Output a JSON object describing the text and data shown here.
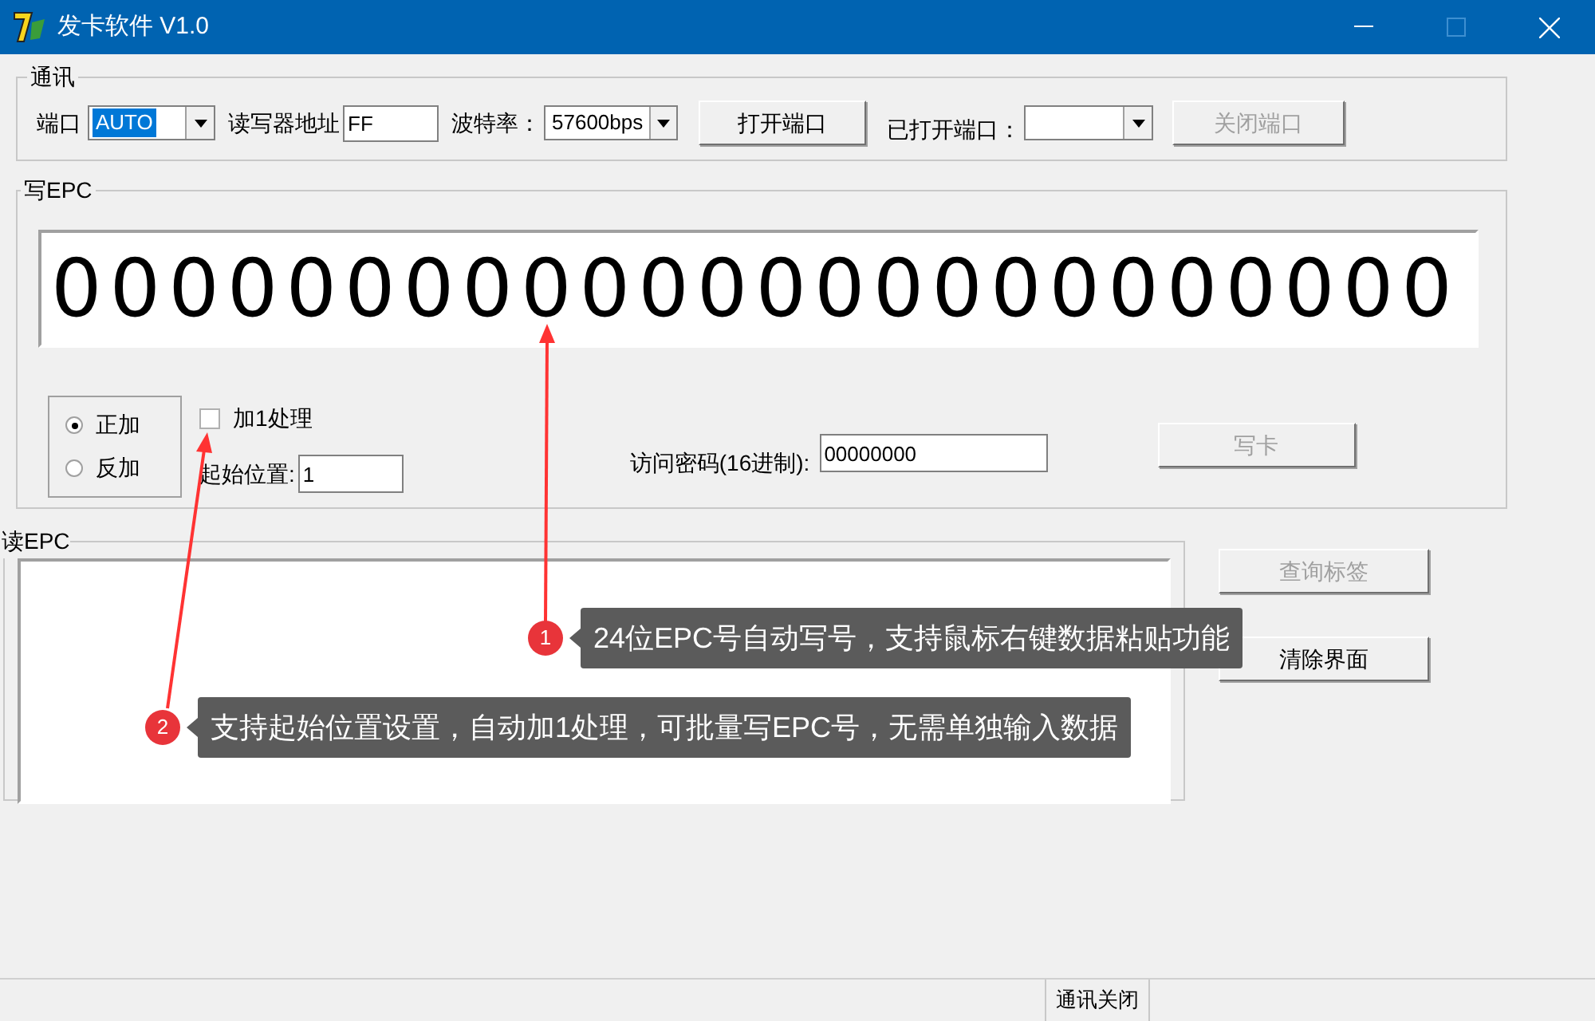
{
  "window": {
    "title": "发卡软件 V1.0"
  },
  "communication": {
    "title": "通讯",
    "port_label": "端口",
    "port_value": "AUTO",
    "port_selected": true,
    "address_label": "读写器地址",
    "address_value": "FF",
    "baud_label": "波特率：",
    "baud_value": "57600bps",
    "open_button": {
      "label": "打开端口",
      "disabled": false
    },
    "opened_port_label": "已打开端口：",
    "close_button": {
      "label": "关闭端口",
      "disabled": true
    }
  },
  "write_epc": {
    "title": "写EPC",
    "epc": "000000000000000000000000",
    "radios": [
      {
        "label": "正加",
        "selected": true
      },
      {
        "label": "反加",
        "selected": false
      }
    ],
    "increment": {
      "label": "加1处理",
      "checked": false
    },
    "start_label": "起始位置:",
    "start_value": "1",
    "password_label": "访问密码(16进制):",
    "password_value": "00000000",
    "write_button": {
      "label": "写卡",
      "disabled": true
    }
  },
  "read_epc": {
    "title": "读EPC",
    "buttons": [
      {
        "label": "查询标签",
        "disabled": true
      },
      {
        "label": "清除界面",
        "disabled": false
      }
    ]
  },
  "status_bar": {
    "text": "通讯关闭"
  },
  "annotations": [
    {
      "number": "1",
      "text": "24位EPC号自动写号，支持鼠标右键数据粘贴功能"
    },
    {
      "number": "2",
      "text": "支持起始位置设置，自动加1处理，可批量写EPC号，无需单独输入数据"
    }
  ]
}
